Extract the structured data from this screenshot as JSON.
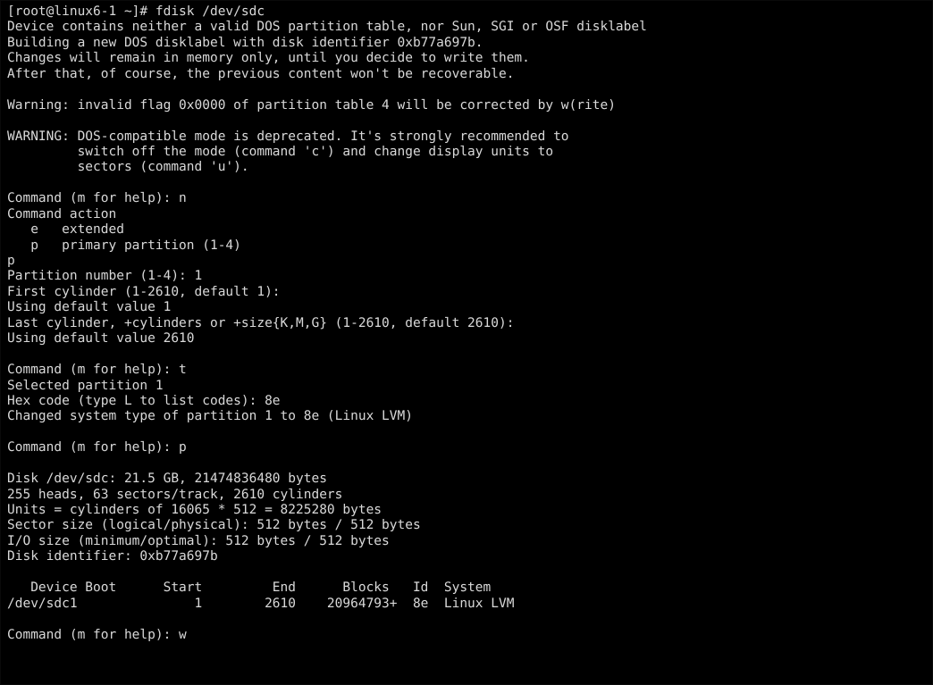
{
  "terminal": {
    "background_color": "#000000",
    "foreground_color": "#d9d9d9",
    "prompt": "[root@linux6-1 ~]#",
    "command": "fdisk /dev/sdc",
    "hostname": "linux6-1",
    "user": "root",
    "cwd": "~",
    "device": "/dev/sdc"
  },
  "disk": {
    "path": "/dev/sdc",
    "size_human": "21.5 GB",
    "size_bytes": "21474836480",
    "heads": "255",
    "sectors_per_track": "63",
    "cylinders": "2610",
    "unit_cylinders": "16065",
    "unit_sector_size": "512",
    "unit_bytes": "8225280",
    "sector_size_logical": "512",
    "sector_size_physical": "512",
    "io_size_minimum": "512",
    "io_size_optimal": "512",
    "identifier": "0xb77a697b"
  },
  "partition_table": {
    "headers": [
      "Device Boot",
      "Start",
      "End",
      "Blocks",
      "Id",
      "System"
    ],
    "rows": [
      {
        "device": "/dev/sdc1",
        "boot": "",
        "start": "1",
        "end": "2610",
        "blocks": "20964793+",
        "id": "8e",
        "system": "Linux LVM"
      }
    ]
  },
  "session": {
    "lines": [
      "[root@linux6-1 ~]# fdisk /dev/sdc",
      "Device contains neither a valid DOS partition table, nor Sun, SGI or OSF disklabel",
      "Building a new DOS disklabel with disk identifier 0xb77a697b.",
      "Changes will remain in memory only, until you decide to write them.",
      "After that, of course, the previous content won't be recoverable.",
      "",
      "Warning: invalid flag 0x0000 of partition table 4 will be corrected by w(rite)",
      "",
      "WARNING: DOS-compatible mode is deprecated. It's strongly recommended to",
      "         switch off the mode (command 'c') and change display units to",
      "         sectors (command 'u').",
      "",
      "Command (m for help): n",
      "Command action",
      "   e   extended",
      "   p   primary partition (1-4)",
      "p",
      "Partition number (1-4): 1",
      "First cylinder (1-2610, default 1):",
      "Using default value 1",
      "Last cylinder, +cylinders or +size{K,M,G} (1-2610, default 2610):",
      "Using default value 2610",
      "",
      "Command (m for help): t",
      "Selected partition 1",
      "Hex code (type L to list codes): 8e",
      "Changed system type of partition 1 to 8e (Linux LVM)",
      "",
      "Command (m for help): p",
      "",
      "Disk /dev/sdc: 21.5 GB, 21474836480 bytes",
      "255 heads, 63 sectors/track, 2610 cylinders",
      "Units = cylinders of 16065 * 512 = 8225280 bytes",
      "Sector size (logical/physical): 512 bytes / 512 bytes",
      "I/O size (minimum/optimal): 512 bytes / 512 bytes",
      "Disk identifier: 0xb77a697b",
      "",
      "   Device Boot      Start         End      Blocks   Id  System",
      "/dev/sdc1               1        2610    20964793+  8e  Linux LVM",
      "",
      "Command (m for help): w"
    ]
  }
}
